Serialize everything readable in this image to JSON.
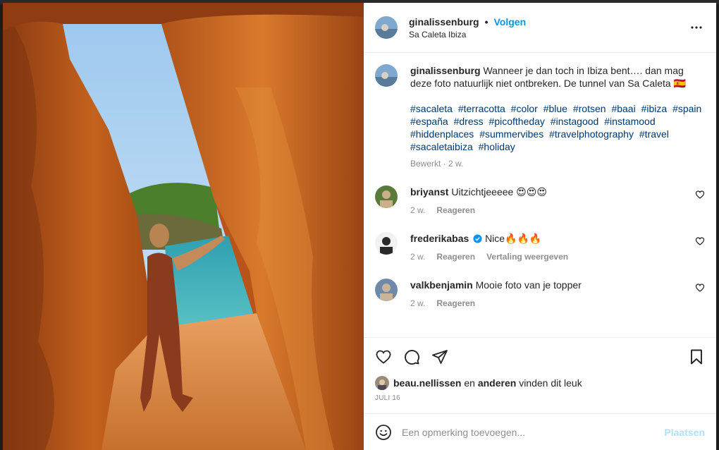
{
  "post": {
    "username": "ginalissenburg",
    "follow_label": "Volgen",
    "location": "Sa Caleta Ibiza",
    "separator": "•"
  },
  "caption": {
    "username": "ginalissenburg",
    "text": "Wanneer je dan toch in Ibiza bent…. dan mag deze foto natuurlijk niet ontbreken. De tunnel van Sa Caleta",
    "emoji": "🇪🇸",
    "hashtags": [
      "#sacaleta",
      "#terracotta",
      "#color",
      "#blue",
      "#rotsen",
      "#baai",
      "#ibiza",
      "#spain",
      "#españa",
      "#dress",
      "#picoftheday",
      "#instagood",
      "#instamood",
      "#hiddenplaces",
      "#summervibes",
      "#travelphotography",
      "#travel",
      "#sacaletaibiza",
      "#holiday"
    ],
    "meta": "Bewerkt · 2 w."
  },
  "comments": [
    {
      "username": "briyanst",
      "text": "Uitzichtjeeeee 😍😍😍",
      "age": "2 w.",
      "reply": "Reageren",
      "translate": "",
      "verified": false
    },
    {
      "username": "frederikabas",
      "text": "Nice🔥🔥🔥",
      "age": "2 w.",
      "reply": "Reageren",
      "translate": "Vertaling weergeven",
      "verified": true
    },
    {
      "username": "valkbenjamin",
      "text": "Mooie foto van je topper",
      "age": "2 w.",
      "reply": "Reageren",
      "translate": "",
      "verified": false
    }
  ],
  "likes": {
    "user": "beau.nellissen",
    "connector": " en ",
    "others": "anderen",
    "suffix": " vinden dit leuk"
  },
  "date": "JULI 16",
  "add_comment": {
    "placeholder": "Een opmerking toevoegen...",
    "post_label": "Plaatsen"
  },
  "icons": {
    "more": "more-horizontal-icon",
    "like": "heart-icon",
    "comment": "comment-bubble-icon",
    "share": "paper-plane-icon",
    "save": "bookmark-icon",
    "emoji": "smiley-icon",
    "verified": "verified-badge-icon"
  },
  "colors": {
    "accent": "#0095f6",
    "hashtag": "#00376b",
    "muted": "#8e8e8e",
    "text": "#262626",
    "post_disabled": "#b2dffc"
  }
}
